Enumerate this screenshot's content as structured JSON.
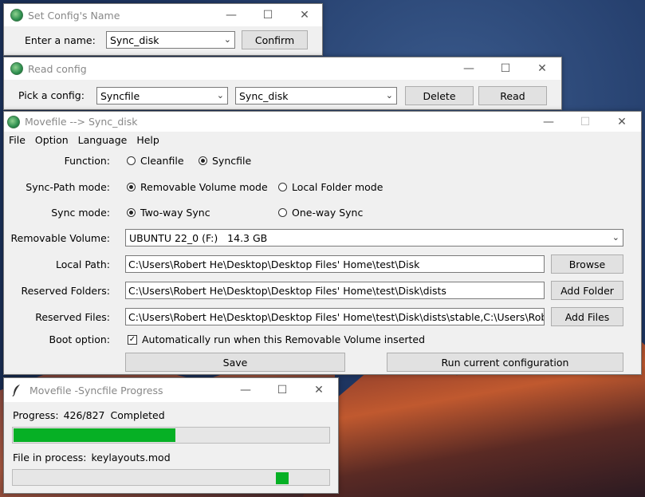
{
  "config_name_window": {
    "title": "Set Config's Name",
    "label": "Enter a name:",
    "value": "Sync_disk",
    "confirm_label": "Confirm"
  },
  "read_config_window": {
    "title": "Read config",
    "label": "Pick a config:",
    "config_type_value": "Syncfile",
    "config_name_value": "Sync_disk",
    "delete_label": "Delete",
    "read_label": "Read"
  },
  "main_window": {
    "title": "Movefile   --> Sync_disk",
    "menu": [
      "File",
      "Option",
      "Language",
      "Help"
    ],
    "function_label": "Function:",
    "function_options": [
      "Cleanfile",
      "Syncfile"
    ],
    "sync_path_label": "Sync-Path mode:",
    "sync_path_options": [
      "Removable Volume mode",
      "Local Folder mode"
    ],
    "sync_mode_label": "Sync mode:",
    "sync_mode_options": [
      "Two-way Sync",
      "One-way Sync"
    ],
    "removable_label": "Removable Volume:",
    "removable_value": "UBUNTU 22_0 (F:)   14.3 GB",
    "local_path_label": "Local Path:",
    "local_path_value": "C:\\Users\\Robert He\\Desktop\\Desktop Files' Home\\test\\Disk",
    "browse_label": "Browse",
    "reserved_folders_label": "Reserved Folders:",
    "reserved_folders_value": "C:\\Users\\Robert He\\Desktop\\Desktop Files' Home\\test\\Disk\\dists",
    "add_folder_label": "Add Folder",
    "reserved_files_label": "Reserved Files:",
    "reserved_files_value": "C:\\Users\\Robert He\\Desktop\\Desktop Files' Home\\test\\Disk\\dists\\stable,C:\\Users\\Robert",
    "add_files_label": "Add Files",
    "boot_label": "Boot option:",
    "boot_checkbox_label": "Automatically run when this Removable Volume inserted",
    "save_label": "Save",
    "run_label": "Run current configuration"
  },
  "progress_window": {
    "title": "Movefile  -Syncfile Progress",
    "progress_label": "Progress:",
    "progress_value": "426/827",
    "progress_status": "Completed",
    "progress_fraction": 0.515,
    "file_label": "File in process:",
    "file_value": "keylayouts.mod",
    "file_progress_indicator": "indeterminate"
  },
  "colors": {
    "progress_fill": "#06b025",
    "focus_border": "#0078d7"
  },
  "window_controls": {
    "minimize": "—",
    "maximize": "☐",
    "close": "✕"
  }
}
